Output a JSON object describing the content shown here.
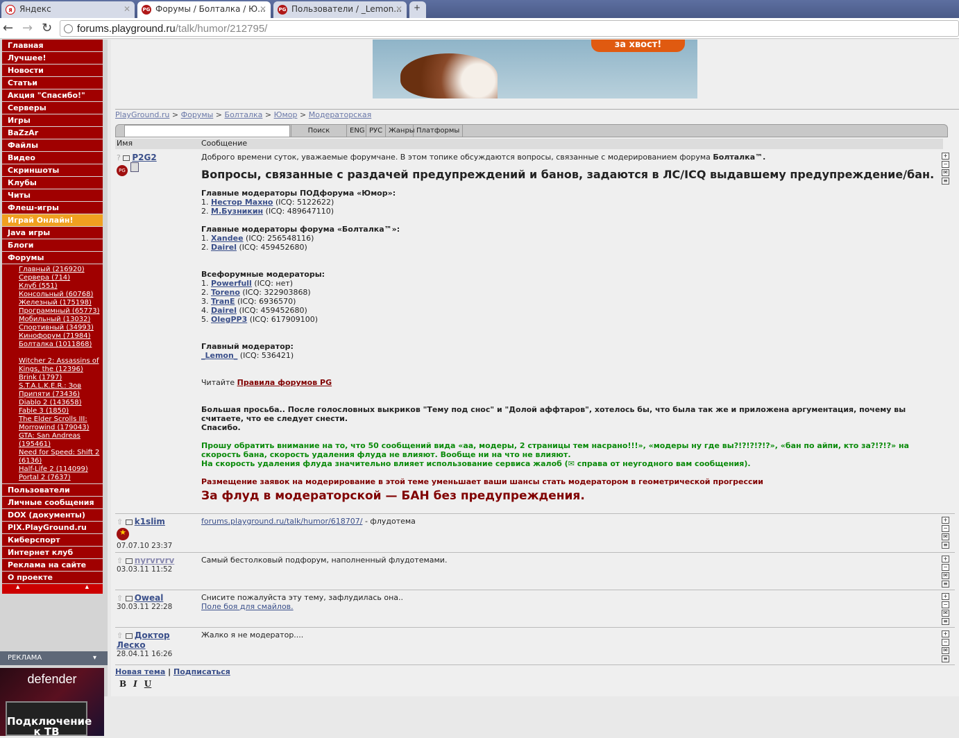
{
  "browser": {
    "tabs": [
      {
        "label": "Яндекс",
        "icon": "Я"
      },
      {
        "label": "Форумы / Болталка / Ю...",
        "icon": "PG"
      },
      {
        "label": "Пользователи / _Lemon...",
        "icon": "PG"
      }
    ],
    "url_host": "forums.playground.ru",
    "url_path": "/talk/humor/212795/"
  },
  "sidebar": {
    "menu": [
      "Главная",
      "Лучшее!",
      "Новости",
      "Статьи",
      "Акция \"Спасибо!\"",
      "Серверы",
      "Игры",
      "BaZzAr",
      "Файлы",
      "Видео",
      "Скриншоты",
      "Клубы",
      "Читы",
      "Флеш-игры",
      "Играй Онлайн!",
      "Java игры",
      "Блоги",
      "Форумы"
    ],
    "forums": [
      "Главный (216920)",
      "Сервера (714)",
      "Клуб (551)",
      "Консольный (60768)",
      "Железный (175198)",
      "Программный (65773)",
      "Мобильный (13032)",
      "Спортивный (34993)",
      "Кинофорум (71984)",
      "Болталка (1011868)"
    ],
    "games": [
      "Witcher 2: Assassins of Kings, the (12396)",
      "Brink (1797)",
      "S.T.A.L.K.E.R.: Зов Припяти (73436)",
      "Diablo 2 (143658)",
      "Fable 3 (1850)",
      "The Elder Scrolls III: Morrowind (179043)",
      "GTA: San Andreas (195461)",
      "Need for Speed: Shift 2 (6136)",
      "Half-Life 2 (114099)",
      "Portal 2 (7637)"
    ],
    "menu2": [
      "Пользователи",
      "Личные сообщения",
      "DOX (документы)",
      "PIX.PlayGround.ru",
      "Киберспорт",
      "Интернет клуб",
      "Реклама на сайте",
      "О проекте"
    ],
    "ad_header": "РЕКЛАМА",
    "ad_brand": "defender",
    "ad_text": "Подключение к ТВ"
  },
  "banner": {
    "text": "за хвост!"
  },
  "breadcrumb": [
    "PlayGround.ru",
    "Форумы",
    "Болталка",
    "Юмор",
    "Модераторская"
  ],
  "search": {
    "button": "Поиск",
    "eng": "ENG",
    "rus": "РУС",
    "genres": "Жанры",
    "platforms": "Платформы"
  },
  "table": {
    "col_name": "Имя",
    "col_msg": "Сообщение"
  },
  "first_post": {
    "author": "P2G2",
    "intro": "Доброго времени суток, уважаемые форумчане. В этом топике обсуждаются вопросы, связанные с модерированием форума ",
    "intro_bold": "Болталка™.",
    "heading": "Вопросы, связанные с раздачей предупреждений и банов, задаются в ЛС/ICQ выдавшему предупреждение/бан.",
    "sec1": "Главные модераторы ПОДфорума «Юмор»:",
    "mods1": [
      [
        "1. ",
        "Нестор Махно",
        " (ICQ: 5122622)"
      ],
      [
        "2. ",
        "М.Бузникин",
        " (ICQ: 489647110)"
      ]
    ],
    "sec2": "Главные модераторы форума «Болталка™»:",
    "mods2": [
      [
        "1. ",
        "Xandee",
        " (ICQ: 256548116)"
      ],
      [
        "2. ",
        "Dairel",
        " (ICQ: 459452680)"
      ]
    ],
    "sec3": "Всефорумные модераторы:",
    "mods3": [
      [
        "1. ",
        "Powerfull",
        " (ICQ: нет)"
      ],
      [
        "2. ",
        "Toreno",
        " (ICQ: 322903868)"
      ],
      [
        "3. ",
        "TranE",
        " (ICQ: 6936570)"
      ],
      [
        "4. ",
        "Dairel",
        " (ICQ: 459452680)"
      ],
      [
        "5. ",
        "OlegPP3",
        " (ICQ: 617909100)"
      ]
    ],
    "sec4": "Главный модератор:",
    "chief": "_Lemon_",
    "chief_icq": " (ICQ: 536421)",
    "read": "Читайте ",
    "rules": "Правила форумов PG",
    "request": "Большая просьба.. После голословных выкриков \"Тему под снос\" и \"Долой аффтаров\", хотелось бы, что была так же и приложена аргументация, почему вы считаете, что ее следует снести.",
    "thanks": "Спасибо.",
    "green1": "Прошу обратить внимание на то, что 50 сообщений вида «аа, модеры, 2 страницы тем насрано!!!», «модеры ну где вы?!?!?!?!?», «бан по айпи, кто за?!?!?» на скорость бана, скорость удаления флуда не влияют. Вообще ни на что не влияют.",
    "green2": "На скорость удаления флуда значительно влияет использование сервиса жалоб (✉ справа от неугодного вам сообщения).",
    "maroon": "Размещение заявок на модерирование в этой теме уменьшает ваши шансы стать модератором в геометрической прогрессии",
    "big": "За флуд в модераторской — БАН без предупреждения."
  },
  "posts": [
    {
      "author": "k1slim",
      "date": "07.07.10 23:37",
      "link": "forums.playground.ru/talk/humor/618707/",
      "text": " - флудотема"
    },
    {
      "author": "nyrvrvrv",
      "date": "03.03.11 11:52",
      "text": "Самый бестолковый подфорум, наполненный флудотемами."
    },
    {
      "author": "Oweal",
      "date": "30.03.11 22:28",
      "text": "Снисите пожалуйста эту тему, зафлудилась она..",
      "link": "Поле боя для смайлов."
    },
    {
      "author": "Доктор Леско",
      "date": "28.04.11 16:26",
      "text": "Жалко я не модератор...."
    }
  ],
  "footer": {
    "new_topic": "Новая тема",
    "subscribe": "Подписаться",
    "bold": "B",
    "italic": "I",
    "underline": "U"
  }
}
